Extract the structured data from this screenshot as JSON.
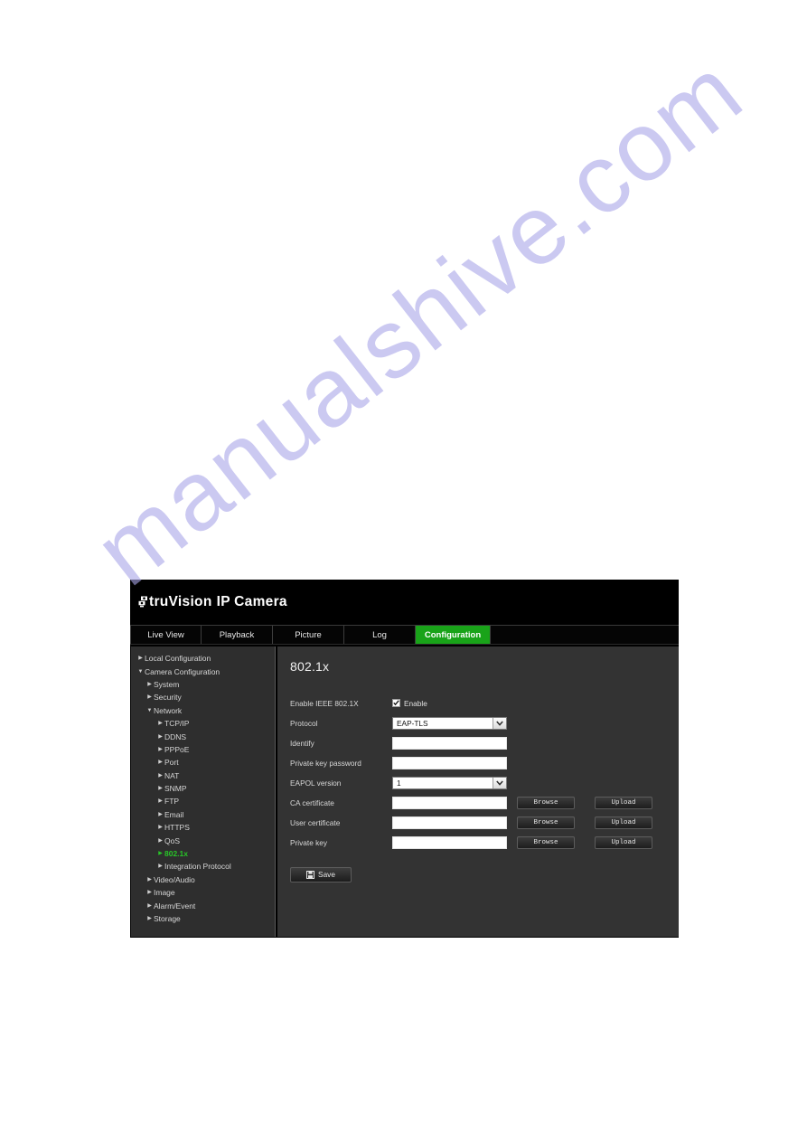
{
  "watermark": {
    "text": "manualshive.com"
  },
  "header": {
    "logo_icon": "camera-icon",
    "brand": "truVision",
    "product": "IP Camera"
  },
  "tabs": [
    {
      "label": "Live View",
      "active": false
    },
    {
      "label": "Playback",
      "active": false
    },
    {
      "label": "Picture",
      "active": false
    },
    {
      "label": "Log",
      "active": false
    },
    {
      "label": "Configuration",
      "active": true
    }
  ],
  "sidebar": {
    "items": [
      {
        "label": "Local Configuration",
        "level": 1,
        "expanded": false,
        "active": false
      },
      {
        "label": "Camera Configuration",
        "level": 1,
        "expanded": true,
        "active": false
      },
      {
        "label": "System",
        "level": 2,
        "expanded": false,
        "active": false
      },
      {
        "label": "Security",
        "level": 2,
        "expanded": false,
        "active": false
      },
      {
        "label": "Network",
        "level": 2,
        "expanded": true,
        "active": false
      },
      {
        "label": "TCP/IP",
        "level": 3,
        "expanded": false,
        "active": false
      },
      {
        "label": "DDNS",
        "level": 3,
        "expanded": false,
        "active": false
      },
      {
        "label": "PPPoE",
        "level": 3,
        "expanded": false,
        "active": false
      },
      {
        "label": "Port",
        "level": 3,
        "expanded": false,
        "active": false
      },
      {
        "label": "NAT",
        "level": 3,
        "expanded": false,
        "active": false
      },
      {
        "label": "SNMP",
        "level": 3,
        "expanded": false,
        "active": false
      },
      {
        "label": "FTP",
        "level": 3,
        "expanded": false,
        "active": false
      },
      {
        "label": "Email",
        "level": 3,
        "expanded": false,
        "active": false
      },
      {
        "label": "HTTPS",
        "level": 3,
        "expanded": false,
        "active": false
      },
      {
        "label": "QoS",
        "level": 3,
        "expanded": false,
        "active": false
      },
      {
        "label": "802.1x",
        "level": 3,
        "expanded": false,
        "active": true
      },
      {
        "label": "Integration Protocol",
        "level": 3,
        "expanded": false,
        "active": false
      },
      {
        "label": "Video/Audio",
        "level": 2,
        "expanded": false,
        "active": false
      },
      {
        "label": "Image",
        "level": 2,
        "expanded": false,
        "active": false
      },
      {
        "label": "Alarm/Event",
        "level": 2,
        "expanded": false,
        "active": false
      },
      {
        "label": "Storage",
        "level": 2,
        "expanded": false,
        "active": false
      }
    ],
    "arrow_collapsed": "▶",
    "arrow_expanded": "▼"
  },
  "panel": {
    "title": "802.1x",
    "enable_row": {
      "label": "Enable IEEE 802.1X",
      "checkbox_label": "Enable",
      "checked": true
    },
    "protocol_row": {
      "label": "Protocol",
      "value": "EAP-TLS"
    },
    "identify_row": {
      "label": "Identify",
      "value": "",
      "placeholder": ""
    },
    "private_key_password_row": {
      "label": "Private key password",
      "value": "",
      "placeholder": ""
    },
    "eapol_row": {
      "label": "EAPOL version",
      "value": "1"
    },
    "file_rows": [
      {
        "label": "CA certificate",
        "value": "",
        "browse_label": "Browse",
        "upload_label": "Upload"
      },
      {
        "label": "User certificate",
        "value": "",
        "browse_label": "Browse",
        "upload_label": "Upload"
      },
      {
        "label": "Private key",
        "value": "",
        "browse_label": "Browse",
        "upload_label": "Upload"
      }
    ],
    "save_button": {
      "label": "Save",
      "icon": "save-icon"
    }
  },
  "colors": {
    "accent_green": "#19a319",
    "header_black": "#000000",
    "sidebar_bg": "#2e2e2e",
    "content_bg": "#333333",
    "watermark": "#a9a6e8"
  }
}
